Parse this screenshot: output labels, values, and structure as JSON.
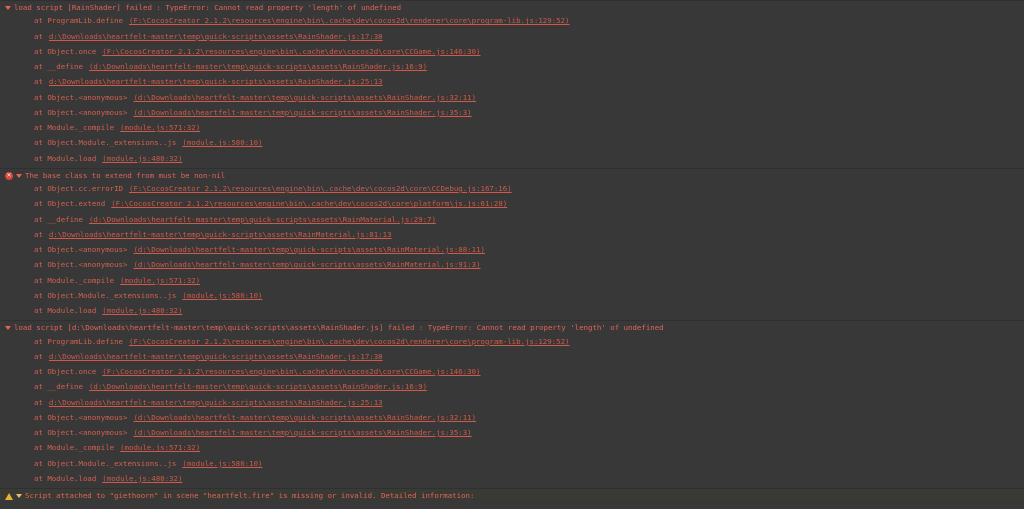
{
  "colors": {
    "background": "#383838",
    "error_text": "#d75f4f",
    "warning_text": "#e2c06a",
    "error_icon": "#d9473d",
    "warning_icon": "#e8b22a"
  },
  "entries": [
    {
      "kind": "error",
      "has_icon": false,
      "message": "load script [RainShader] failed : TypeError: Cannot read property 'length' of undefined",
      "frames": [
        {
          "at": "at ProgramLib.define",
          "link": "(F:\\CocosCreator_2.1.2\\resources\\engine\\bin\\.cache\\dev\\cocos2d\\renderer\\core\\program-lib.js:129:52)"
        },
        {
          "at": "at",
          "link": "d:\\Downloads\\heartfelt-master\\temp\\quick-scripts\\assets\\RainShader.js:17:38"
        },
        {
          "at": "at Object.once",
          "link": "(F:\\CocosCreator_2.1.2\\resources\\engine\\bin\\.cache\\dev\\cocos2d\\core\\CCGame.js:146:30)"
        },
        {
          "at": "at __define",
          "link": "(d:\\Downloads\\heartfelt-master\\temp\\quick-scripts\\assets\\RainShader.js:16:9)"
        },
        {
          "at": "at",
          "link": "d:\\Downloads\\heartfelt-master\\temp\\quick-scripts\\assets\\RainShader.js:25:13"
        },
        {
          "at": "at Object.<anonymous>",
          "link": "(d:\\Downloads\\heartfelt-master\\temp\\quick-scripts\\assets\\RainShader.js:32:11)"
        },
        {
          "at": "at Object.<anonymous>",
          "link": "(d:\\Downloads\\heartfelt-master\\temp\\quick-scripts\\assets\\RainShader.js:35:3)"
        },
        {
          "at": "at Module._compile",
          "link": "(module.js:571:32)"
        },
        {
          "at": "at Object.Module._extensions..js",
          "link": "(module.js:580:10)"
        },
        {
          "at": "at Module.load",
          "link": "(module.js:488:32)"
        }
      ]
    },
    {
      "kind": "error",
      "has_icon": true,
      "icon_glyph": "✕",
      "message": "The base class to extend from must be non-nil",
      "frames": [
        {
          "at": "at Object.cc.errorID",
          "link": "(F:\\CocosCreator_2.1.2\\resources\\engine\\bin\\.cache\\dev\\cocos2d\\core\\CCDebug.js:167:16)"
        },
        {
          "at": "at Object.extend",
          "link": "(F:\\CocosCreator_2.1.2\\resources\\engine\\bin\\.cache\\dev\\cocos2d\\core\\platform\\js.js:61:28)"
        },
        {
          "at": "at __define",
          "link": "(d:\\Downloads\\heartfelt-master\\temp\\quick-scripts\\assets\\RainMaterial.js:29:7)"
        },
        {
          "at": "at",
          "link": "d:\\Downloads\\heartfelt-master\\temp\\quick-scripts\\assets\\RainMaterial.js:81:13"
        },
        {
          "at": "at Object.<anonymous>",
          "link": "(d:\\Downloads\\heartfelt-master\\temp\\quick-scripts\\assets\\RainMaterial.js:88:11)"
        },
        {
          "at": "at Object.<anonymous>",
          "link": "(d:\\Downloads\\heartfelt-master\\temp\\quick-scripts\\assets\\RainMaterial.js:91:3)"
        },
        {
          "at": "at Module._compile",
          "link": "(module.js:571:32)"
        },
        {
          "at": "at Object.Module._extensions..js",
          "link": "(module.js:580:10)"
        },
        {
          "at": "at Module.load",
          "link": "(module.js:488:32)"
        }
      ]
    },
    {
      "kind": "error",
      "has_icon": false,
      "message": "load script [d:\\Downloads\\heartfelt-master\\temp\\quick-scripts\\assets\\RainShader.js] failed : TypeError: Cannot read property 'length' of undefined",
      "frames": [
        {
          "at": "at ProgramLib.define",
          "link": "(F:\\CocosCreator_2.1.2\\resources\\engine\\bin\\.cache\\dev\\cocos2d\\renderer\\core\\program-lib.js:129:52)"
        },
        {
          "at": "at",
          "link": "d:\\Downloads\\heartfelt-master\\temp\\quick-scripts\\assets\\RainShader.js:17:38"
        },
        {
          "at": "at Object.once",
          "link": "(F:\\CocosCreator_2.1.2\\resources\\engine\\bin\\.cache\\dev\\cocos2d\\core\\CCGame.js:146:30)"
        },
        {
          "at": "at __define",
          "link": "(d:\\Downloads\\heartfelt-master\\temp\\quick-scripts\\assets\\RainShader.js:16:9)"
        },
        {
          "at": "at",
          "link": "d:\\Downloads\\heartfelt-master\\temp\\quick-scripts\\assets\\RainShader.js:25:13"
        },
        {
          "at": "at Object.<anonymous>",
          "link": "(d:\\Downloads\\heartfelt-master\\temp\\quick-scripts\\assets\\RainShader.js:32:11)"
        },
        {
          "at": "at Object.<anonymous>",
          "link": "(d:\\Downloads\\heartfelt-master\\temp\\quick-scripts\\assets\\RainShader.js:35:3)"
        },
        {
          "at": "at Module._compile",
          "link": "(module.js:571:32)"
        },
        {
          "at": "at Object.Module._extensions..js",
          "link": "(module.js:580:10)"
        },
        {
          "at": "at Module.load",
          "link": "(module.js:488:32)"
        }
      ]
    },
    {
      "kind": "warning",
      "has_icon": true,
      "message": "Script attached to \"giethoorn\" in scene \"heartfelt.fire\" is missing or invalid. Detailed information:",
      "frames": []
    }
  ]
}
